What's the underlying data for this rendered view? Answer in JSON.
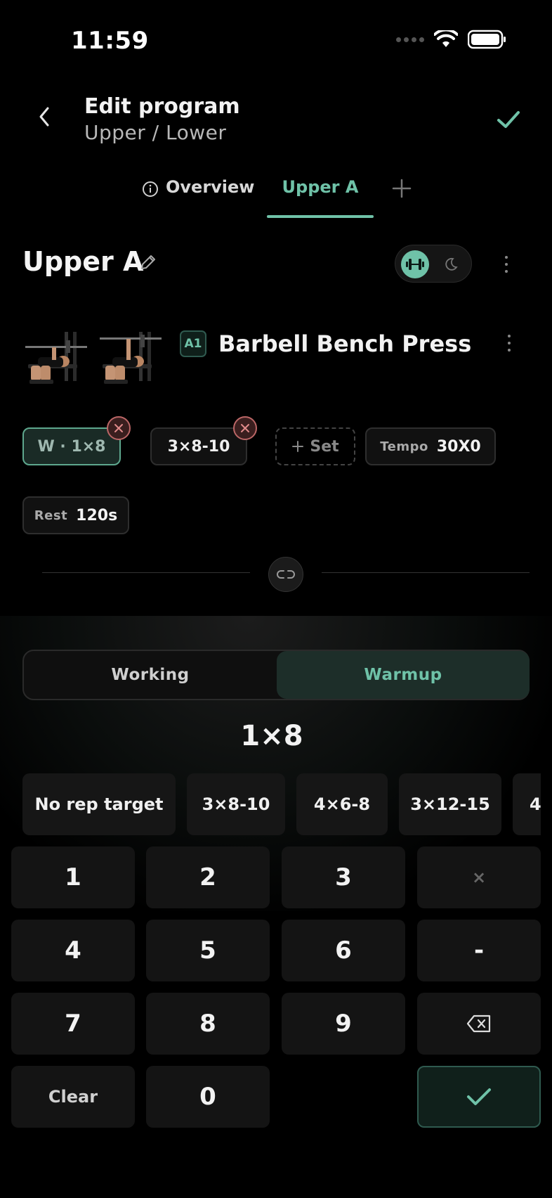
{
  "status_bar": {
    "time": "11:59"
  },
  "header": {
    "title": "Edit program",
    "subtitle": "Upper / Lower"
  },
  "tabs": [
    {
      "label": "Overview"
    },
    {
      "label": "Upper A"
    }
  ],
  "day": {
    "title": "Upper A"
  },
  "exercise": {
    "badge": "A1",
    "name": "Barbell Bench Press"
  },
  "sets": {
    "warmup_chip": "W · 1×8",
    "working_chip": "3×8-10",
    "add_set_label": "Set",
    "tempo_label": "Tempo",
    "tempo_value": "30X0",
    "rest_label": "Rest",
    "rest_value": "120s"
  },
  "editor": {
    "segments": [
      "Working",
      "Warmup"
    ],
    "selected_segment": "Warmup",
    "current_value": "1×8",
    "presets": [
      "No rep target",
      "3×8-10",
      "4×6-8",
      "3×12-15",
      "4"
    ]
  },
  "keypad": {
    "keys": [
      "1",
      "2",
      "3",
      "×",
      "4",
      "5",
      "6",
      "-",
      "7",
      "8",
      "9",
      "Clear",
      "0"
    ]
  },
  "colors": {
    "accent": "#6fc2a8",
    "background": "#000000",
    "danger": "#b66666"
  }
}
